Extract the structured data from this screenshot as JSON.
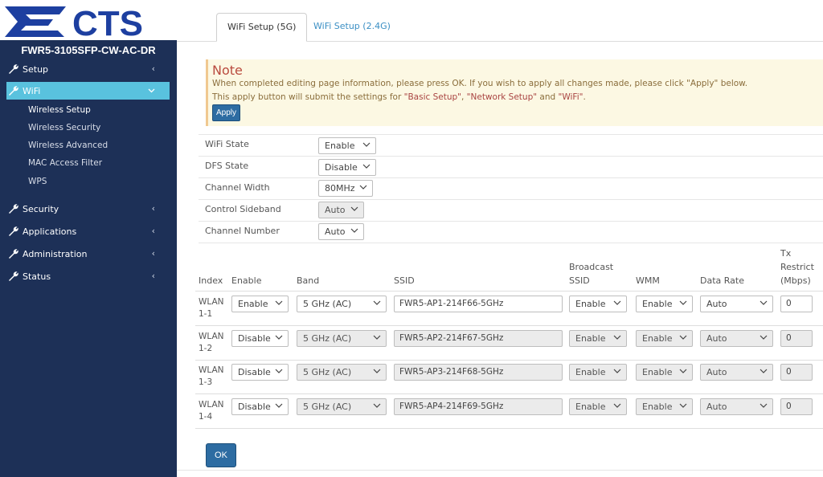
{
  "brand": {
    "logo_text": "CTS",
    "model": "FWR5-3105SFP-CW-AC-DR"
  },
  "sidebar": {
    "items": [
      {
        "label": "Setup",
        "icon": "wrench-icon"
      },
      {
        "label": "WiFi",
        "icon": "wrench-icon",
        "active": true
      },
      {
        "label": "Security",
        "icon": "wrench-icon"
      },
      {
        "label": "Applications",
        "icon": "wrench-icon"
      },
      {
        "label": "Administration",
        "icon": "wrench-icon"
      },
      {
        "label": "Status",
        "icon": "wrench-icon"
      }
    ],
    "wifi_sub": [
      {
        "label": "Wireless Setup",
        "current": true
      },
      {
        "label": "Wireless Security"
      },
      {
        "label": "Wireless Advanced"
      },
      {
        "label": "MAC Access Filter"
      },
      {
        "label": "WPS"
      }
    ]
  },
  "tabs": [
    {
      "label": "WiFi Setup (5G)",
      "active": true
    },
    {
      "label": "WiFi Setup (2.4G)"
    }
  ],
  "note": {
    "title": "Note",
    "line1": "When completed editing page information, please press OK. If you wish to apply all changes made, please click \"Apply\" below.",
    "line2_prefix": "This apply button will submit the settings for ",
    "line2_basic": "\"Basic Setup\"",
    "line2_sep1": ", ",
    "line2_network": "\"Network Setup\"",
    "line2_and": " and ",
    "line2_wifi": "\"WiFi\"",
    "line2_end": ".",
    "apply_label": "Apply"
  },
  "settings": [
    {
      "label": "WiFi State",
      "value": "Enable"
    },
    {
      "label": "DFS State",
      "value": "Disable"
    },
    {
      "label": "Channel Width",
      "value": "80MHz"
    },
    {
      "label": "Control Sideband",
      "value": "Auto",
      "disabled": true
    },
    {
      "label": "Channel Number",
      "value": "Auto"
    }
  ],
  "wlan_table": {
    "headers": {
      "index": "Index",
      "enable": "Enable",
      "band": "Band",
      "ssid": "SSID",
      "broadcast_1": "Broadcast",
      "broadcast_2": "SSID",
      "wmm": "WMM",
      "data_rate": "Data Rate",
      "tx_1": "Tx",
      "tx_2": "Restrict",
      "tx_3": "(Mbps)"
    },
    "rows": [
      {
        "index_1": "WLAN",
        "index_2": "1-1",
        "enable": "Enable",
        "band": "5 GHz (AC)",
        "ssid": "FWR5-AP1-214F66-5GHz",
        "broadcast": "Enable",
        "wmm": "Enable",
        "data_rate": "Auto",
        "tx": "0",
        "disabled": false
      },
      {
        "index_1": "WLAN",
        "index_2": "1-2",
        "enable": "Disable",
        "band": "5 GHz (AC)",
        "ssid": "FWR5-AP2-214F67-5GHz",
        "broadcast": "Enable",
        "wmm": "Enable",
        "data_rate": "Auto",
        "tx": "0",
        "disabled": true
      },
      {
        "index_1": "WLAN",
        "index_2": "1-3",
        "enable": "Disable",
        "band": "5 GHz (AC)",
        "ssid": "FWR5-AP3-214F68-5GHz",
        "broadcast": "Enable",
        "wmm": "Enable",
        "data_rate": "Auto",
        "tx": "0",
        "disabled": true
      },
      {
        "index_1": "WLAN",
        "index_2": "1-4",
        "enable": "Disable",
        "band": "5 GHz (AC)",
        "ssid": "FWR5-AP4-214F69-5GHz",
        "broadcast": "Enable",
        "wmm": "Enable",
        "data_rate": "Auto",
        "tx": "0",
        "disabled": true
      }
    ]
  },
  "ok_label": "OK"
}
